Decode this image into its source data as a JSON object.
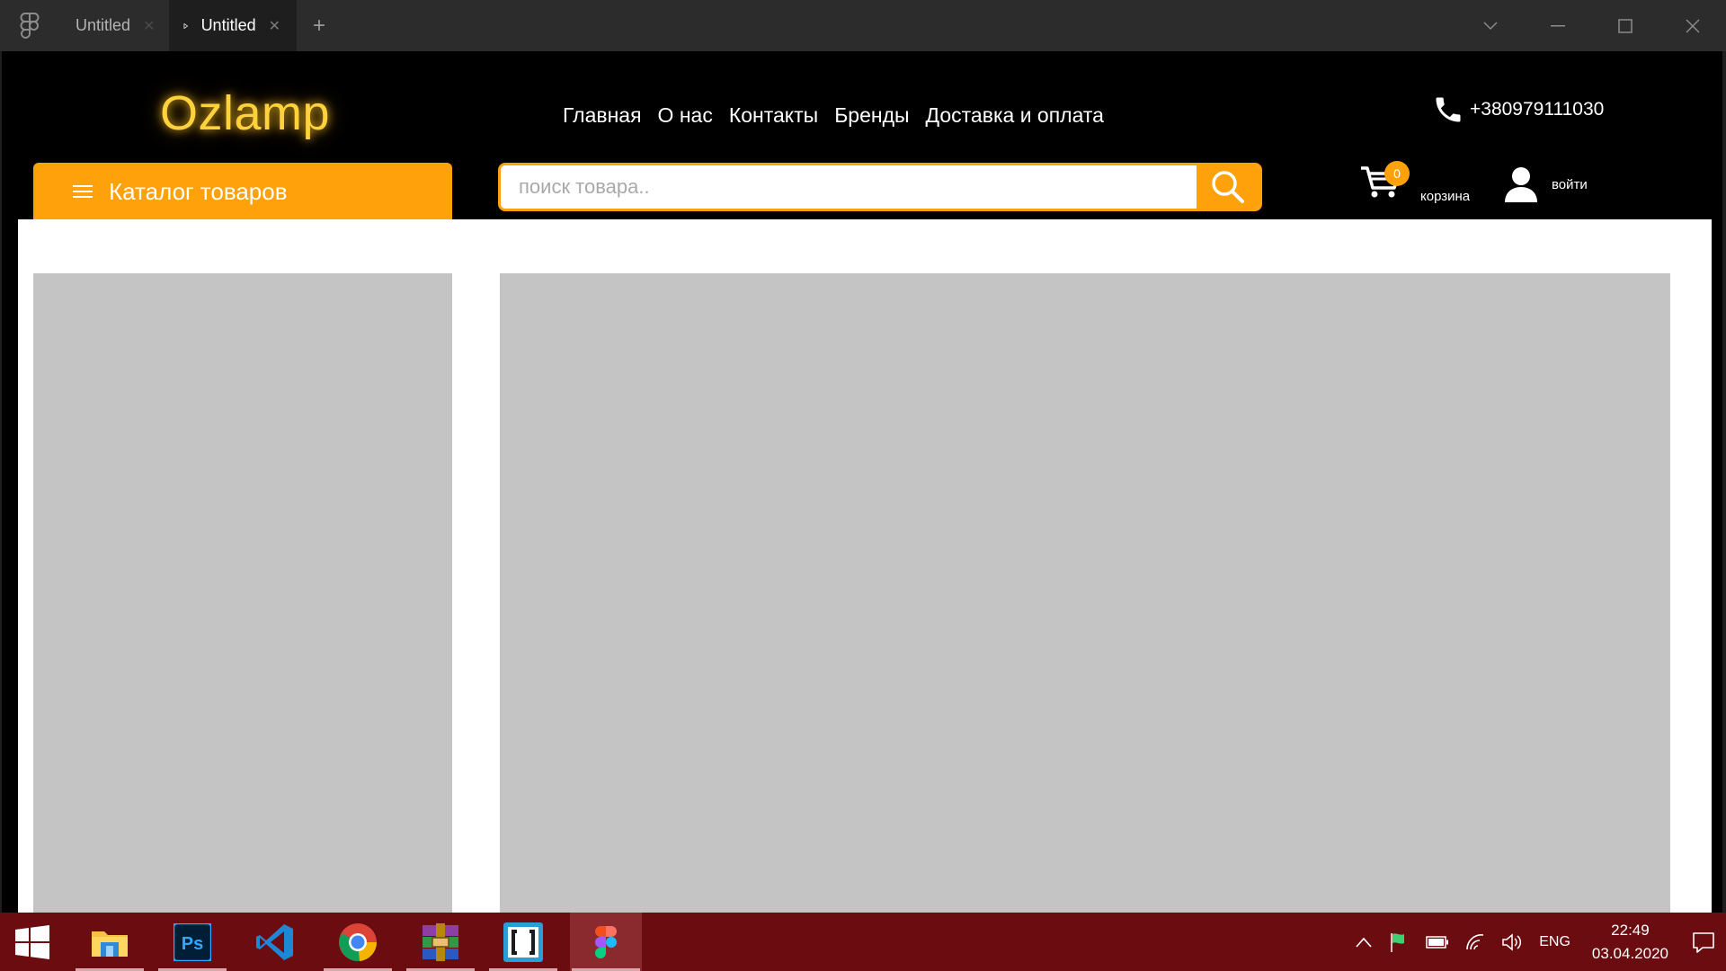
{
  "titlebar": {
    "tabs": [
      {
        "label": "Untitled",
        "active": false
      },
      {
        "label": "Untitled",
        "active": true
      }
    ],
    "new_tab_symbol": "+",
    "close_symbol": "✕"
  },
  "site": {
    "logo": "Ozlamp",
    "nav": [
      "Главная",
      "О нас",
      "Контакты",
      "Бренды",
      "Доставка и оплата"
    ],
    "phone": "+380979111030",
    "catalog_button": "Каталог товаров",
    "search": {
      "placeholder": "поиск товара.."
    },
    "cart": {
      "count": "0",
      "label": "корзина"
    },
    "login_label": "войти"
  },
  "taskbar": {
    "apps": [
      "file-explorer",
      "photoshop",
      "vscode",
      "chrome",
      "winrar",
      "brackets",
      "figma"
    ],
    "language": "ENG",
    "time": "22:49",
    "date": "03.04.2020"
  },
  "colors": {
    "accent": "#ffa10b",
    "logo": "#ffd23c",
    "placeholder_block": "#c4c4c4",
    "taskbar": "#6b0c10",
    "titlebar": "#2c2c2c"
  }
}
